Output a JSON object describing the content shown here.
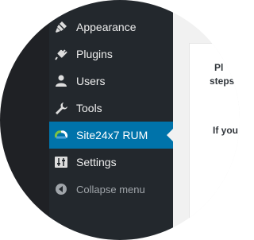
{
  "sidebar": {
    "items": [
      {
        "label": "Appearance",
        "icon": "paintbrush-icon"
      },
      {
        "label": "Plugins",
        "icon": "plugin-icon"
      },
      {
        "label": "Users",
        "icon": "user-icon"
      },
      {
        "label": "Tools",
        "icon": "wrench-icon"
      },
      {
        "label": "Site24x7 RUM",
        "icon": "site24x7-logo-icon",
        "current": true
      },
      {
        "label": "Settings",
        "icon": "settings-sliders-icon"
      }
    ],
    "collapse_label": "Collapse menu"
  },
  "content": {
    "line1": "Pl",
    "line2": "steps",
    "line3": "If you"
  },
  "colors": {
    "sidebar_bg": "#23282d",
    "accent": "#0073aa",
    "content_bg": "#f1f1f1"
  }
}
